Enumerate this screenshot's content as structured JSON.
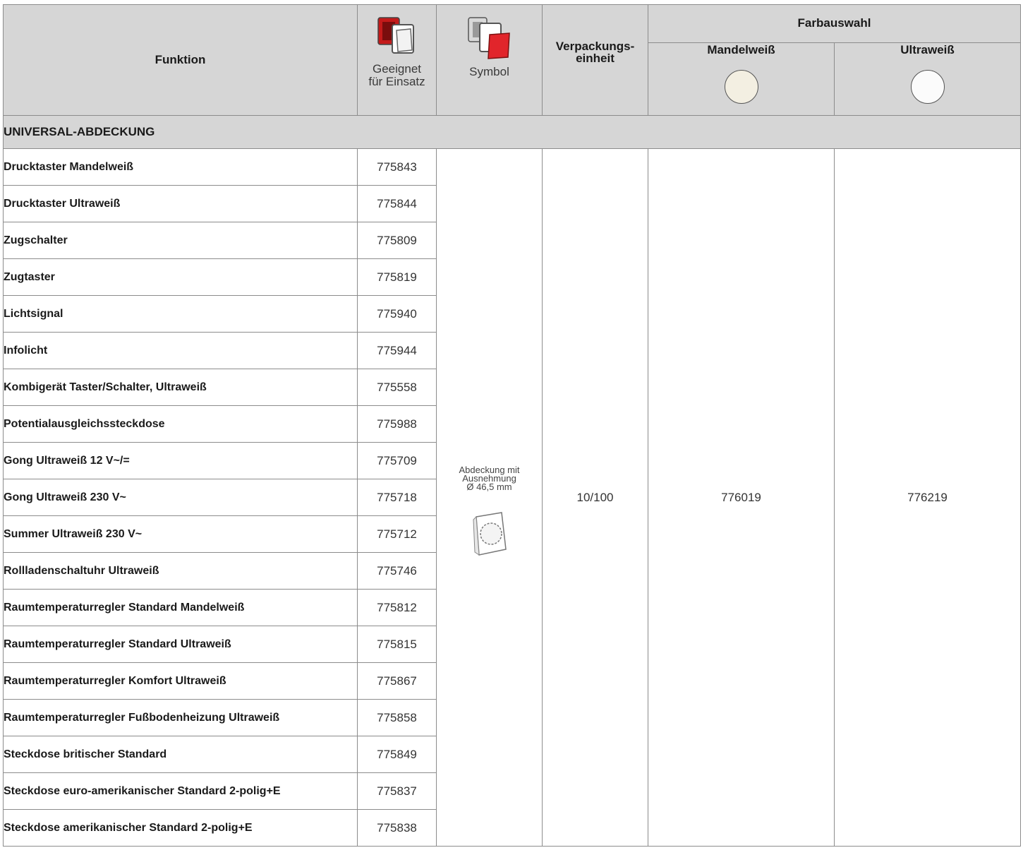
{
  "header": {
    "funktion": "Funktion",
    "geeignet_line1": "Geeignet",
    "geeignet_line2": "für Einsatz",
    "symbol": "Symbol",
    "verpackung_line1": "Verpackungs-",
    "verpackung_line2": "einheit",
    "farbauswahl": "Farbauswahl",
    "colors": [
      {
        "name": "Mandelweiß",
        "swatch": "#f3efe2"
      },
      {
        "name": "Ultraweiß",
        "swatch": "#fbfbfb"
      }
    ],
    "icons": [
      "mechanism-insert-icon",
      "cover-plate-icon"
    ]
  },
  "section": {
    "title": "UNIVERSAL-ABDECKUNG"
  },
  "rows": [
    {
      "funktion": "Drucktaster Mandelweiß",
      "ref": "775843"
    },
    {
      "funktion": "Drucktaster Ultraweiß",
      "ref": "775844"
    },
    {
      "funktion": "Zugschalter",
      "ref": "775809"
    },
    {
      "funktion": "Zugtaster",
      "ref": "775819"
    },
    {
      "funktion": "Lichtsignal",
      "ref": "775940"
    },
    {
      "funktion": "Infolicht",
      "ref": "775944"
    },
    {
      "funktion": "Kombigerät Taster/Schalter, Ultraweiß",
      "ref": "775558"
    },
    {
      "funktion": "Potentialausgleichssteckdose",
      "ref": "775988"
    },
    {
      "funktion": "Gong Ultraweiß 12 V~/=",
      "ref": "775709"
    },
    {
      "funktion": "Gong Ultraweiß 230 V~",
      "ref": "775718"
    },
    {
      "funktion": "Summer Ultraweiß 230 V~",
      "ref": "775712"
    },
    {
      "funktion": "Rollladenschaltuhr Ultraweiß",
      "ref": "775746"
    },
    {
      "funktion": "Raumtemperaturregler Standard Mandelweiß",
      "ref": "775812"
    },
    {
      "funktion": "Raumtemperaturregler Standard Ultraweiß",
      "ref": "775815"
    },
    {
      "funktion": "Raumtemperaturregler Komfort Ultraweiß",
      "ref": "775867"
    },
    {
      "funktion": "Raumtemperaturregler Fußbodenheizung Ultraweiß",
      "ref": "775858"
    },
    {
      "funktion": "Steckdose britischer Standard",
      "ref": "775849"
    },
    {
      "funktion": "Steckdose euro-amerikanischer Standard 2-polig+E",
      "ref": "775837"
    },
    {
      "funktion": "Steckdose amerikanischer Standard 2-polig+E",
      "ref": "775838"
    }
  ],
  "merged": {
    "symbol_line1": "Abdeckung mit",
    "symbol_line2": "Ausnehmung",
    "symbol_line3": "Ø 46,5 mm",
    "symbol_icon": "cover-with-cutout-icon",
    "verpackung": "10/100",
    "mandelweiss_ref": "776019",
    "ultraweiss_ref": "776219"
  }
}
